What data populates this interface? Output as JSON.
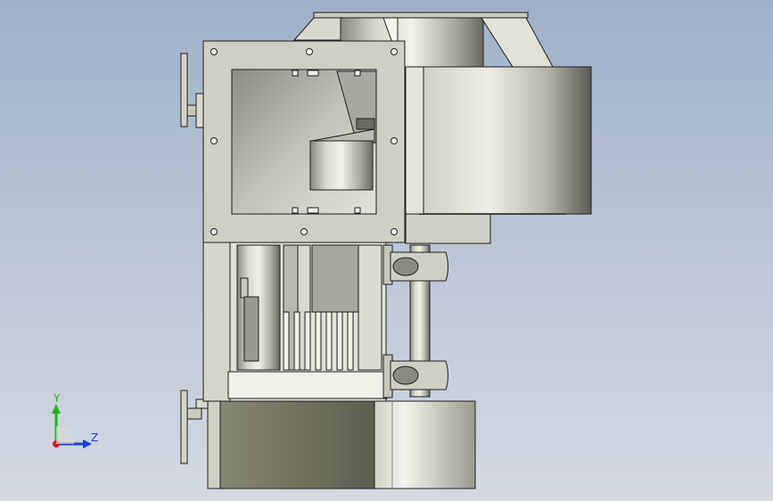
{
  "viewport": {
    "background_top": "#9eb0c9",
    "background_bottom": "#d4d9e2"
  },
  "model": {
    "description_icon": "centrifugal-fan-assembly",
    "colors": {
      "metal_light": "#e6e6dc",
      "metal_mid": "#b4b4a8",
      "metal_dark": "#6e6e62",
      "edge": "#1e1e1e"
    }
  },
  "triad": {
    "y_label": "Y",
    "z_label": "Z",
    "y_color": "#1fb31f",
    "z_color": "#1c3fd6",
    "x_color": "#d81b1b"
  }
}
